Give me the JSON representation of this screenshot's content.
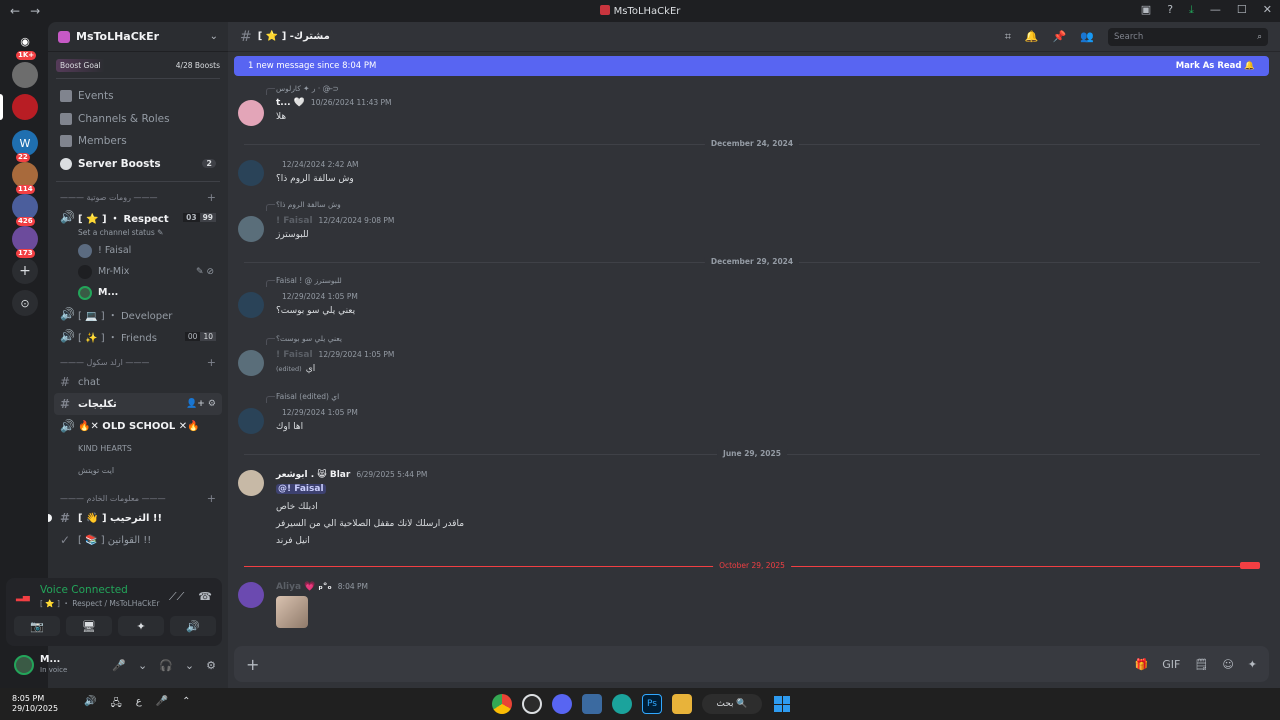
{
  "window": {
    "title": "MsToLHaCkEr",
    "back": "←",
    "forward": "→",
    "controls": [
      "▣",
      "?",
      "⤓",
      "—",
      "☐",
      "✕"
    ]
  },
  "guilds": [
    {
      "badge": "1K+",
      "color": "#5865f2",
      "label": "◉"
    },
    {
      "badge": "",
      "color": "#6d6d6d",
      "label": ""
    },
    {
      "badge": "",
      "color": "#b81d24",
      "label": ""
    },
    {
      "badge": "22",
      "color": "#1f6fb0",
      "label": "W"
    },
    {
      "badge": "114",
      "color": "#a86a3c",
      "label": ""
    },
    {
      "badge": "426",
      "color": "#4b5e9c",
      "label": ""
    },
    {
      "badge": "173",
      "color": "#6c4b9c",
      "label": ""
    }
  ],
  "add_server": "+",
  "discover": "⊙",
  "server": {
    "name": "MsToLHaCkEr",
    "boost_goal": "Boost Goal",
    "boost_progress": "4/28 Boosts",
    "menu": [
      {
        "label": "Events",
        "count": ""
      },
      {
        "label": "Channels & Roles",
        "count": ""
      },
      {
        "label": "Members",
        "count": ""
      },
      {
        "label": "Server Boosts",
        "count": "2"
      }
    ]
  },
  "categories": [
    {
      "name": "——— رومات صوتية ———",
      "plus": "+"
    },
    {
      "name": "——— ارلد سكول ———",
      "plus": "+"
    },
    {
      "name": "——— معلومات الخادم ———",
      "plus": "+"
    }
  ],
  "voice_channels_1": [
    {
      "name": "[ ⭐ ] ・ Respect",
      "status": "Set a channel status ✎",
      "count_a": "03",
      "count_b": "99"
    }
  ],
  "voice_users": [
    {
      "name": "! Faisal",
      "icons": ""
    },
    {
      "name": "Mr-Mix",
      "icons": "✎ ⊘"
    },
    {
      "name": "M...",
      "icons": ""
    }
  ],
  "voice_channels_2": [
    {
      "name": "[ 💻 ] ・ Developer",
      "count_a": "",
      "count_b": ""
    },
    {
      "name": "[ ✨ ] ・ Friends",
      "count_a": "00",
      "count_b": "10"
    }
  ],
  "text_channels": [
    {
      "name": "chat",
      "kind": "#"
    },
    {
      "name": "تكليجات",
      "kind": "#"
    },
    {
      "name": "🔥✕ OLD SCHOOL ✕🔥",
      "kind": "🔊"
    },
    {
      "name": "KIND HEARTS",
      "kind": ""
    },
    {
      "name": "ايت تويتش",
      "kind": ""
    }
  ],
  "info_channels": [
    {
      "name": "[ 👋 ] الترحيب !!",
      "kind": "#"
    },
    {
      "name": "[ 📚 ] القوانين !!",
      "kind": "✓"
    }
  ],
  "voice_panel": {
    "status": "Voice Connected",
    "location": "[ ⭐ ] ・ Respect / MsToLHaCkEr",
    "btns": [
      "📷",
      "🖥",
      "✦",
      "🔊"
    ]
  },
  "user": {
    "name": "M...",
    "sub": "In voice",
    "icons": [
      "🎤",
      "⌄",
      "🎧",
      "⌄",
      "⚙"
    ]
  },
  "channel_header": {
    "name": "[ ⭐ ] -مشترك",
    "search_placeholder": "Search",
    "icons": [
      "⌗",
      "🔔",
      "📌",
      "👥"
    ]
  },
  "new_banner": {
    "text": "1 new message since 8:04 PM",
    "mark": "Mark As Read 🔔"
  },
  "messages": [
    {
      "reply": "ر ✦ كارلوس · @ ⊃̶",
      "author": "t...",
      "badge": "🤍",
      "ts": "10/26/2024 11:43 PM",
      "text": "هلا"
    },
    {
      "reply": "",
      "author": "",
      "badge": "",
      "ts": "12/24/2024 2:42 AM",
      "text": "وش سالفة الروم ذا؟"
    },
    {
      "reply": "وش سالفة الروم ذا؟",
      "author": "! Faisal",
      "badge": "",
      "ts": "12/24/2024 9:08 PM",
      "text": "للبوسترز"
    },
    {
      "reply": "Faisal ! @ للبوسترز",
      "author": "",
      "badge": "",
      "ts": "12/29/2024 1:05 PM",
      "text": "يعني يلي سو بوست؟"
    },
    {
      "reply": "يعني يلي سو بوست؟",
      "author": "! Faisal",
      "badge": "",
      "ts": "12/29/2024 1:05 PM",
      "text": "اي",
      "edited": "(edited)"
    },
    {
      "reply": "Faisal (edited) اي",
      "author": "",
      "badge": "",
      "ts": "12/29/2024 1:05 PM",
      "text": "اها اوك"
    },
    {
      "reply": "",
      "author": "ابوشعر .",
      "badge": "😸 Blar",
      "ts": "6/29/2025 5:44 PM",
      "mention": "@! Faisal",
      "lines": [
        "ادبلك خاص",
        "ماقدر ارسلك لانك مقفل الصلاحية الي من السيرفر",
        "انيل فرند"
      ]
    },
    {
      "reply": "",
      "author": "Aliya",
      "badge": "💗 ₚ°ₒ",
      "ts": "8:04 PM",
      "text": ""
    }
  ],
  "date_separators": [
    "December 24, 2024",
    "December 29, 2024",
    "June 29, 2025",
    "October 29, 2025"
  ],
  "new_tag": "NEW",
  "composer": {
    "plus": "+",
    "icons": [
      "🎁",
      "GIF",
      "🗒",
      "☺",
      "✦"
    ]
  },
  "taskbar": {
    "time": "8:05 PM",
    "date": "29/10/2025",
    "tray": [
      "🔊",
      "🖧",
      "ع",
      "🎤",
      "⌃"
    ],
    "search": "بحث 🔍"
  },
  "colors": {
    "accent": "#5865f2",
    "online": "#23a55a",
    "danger": "#f23f43"
  }
}
